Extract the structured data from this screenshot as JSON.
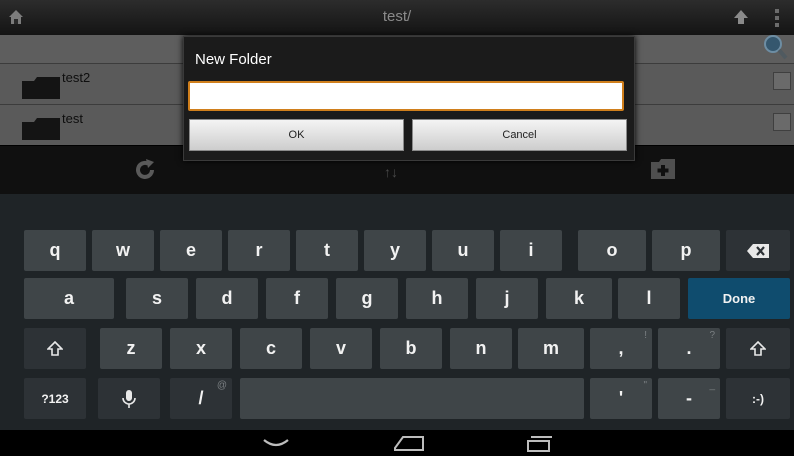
{
  "app": {
    "title": "test/"
  },
  "files": [
    {
      "name": "test2"
    },
    {
      "name": "test"
    }
  ],
  "toolbar": {
    "sort_glyph": "↑↓"
  },
  "dialog": {
    "title": "New Folder",
    "input_value": "",
    "ok_label": "OK",
    "cancel_label": "Cancel",
    "accent": "#d07f1c"
  },
  "keyboard": {
    "row1": [
      "q",
      "w",
      "e",
      "r",
      "t",
      "y",
      "u",
      "i",
      "o",
      "p"
    ],
    "row2": [
      "a",
      "s",
      "d",
      "f",
      "g",
      "h",
      "j",
      "k",
      "l"
    ],
    "row3": [
      "z",
      "x",
      "c",
      "v",
      "b",
      "n",
      "m"
    ],
    "comma": ",",
    "comma_hint": "!",
    "period": ".",
    "period_hint": "?",
    "slash": "/",
    "slash_hint": "@",
    "apostrophe": "'",
    "apostrophe_hint": "\"",
    "dash": "-",
    "dash_hint": "_",
    "symbols_label": "?123",
    "smiley_label": ":-)",
    "done_label": "Done",
    "done_color": "#0f4c6e"
  },
  "icons": {
    "home": "home-icon",
    "up": "arrow-up-icon",
    "overflow": "overflow-menu-icon",
    "search": "search-icon",
    "folder": "folder-icon",
    "refresh": "refresh-icon",
    "new_folder": "new-folder-icon",
    "backspace": "backspace-icon",
    "shift": "shift-icon",
    "mic": "microphone-icon",
    "back": "back-icon",
    "nav_home": "nav-home-icon",
    "recents": "recent-apps-icon"
  }
}
